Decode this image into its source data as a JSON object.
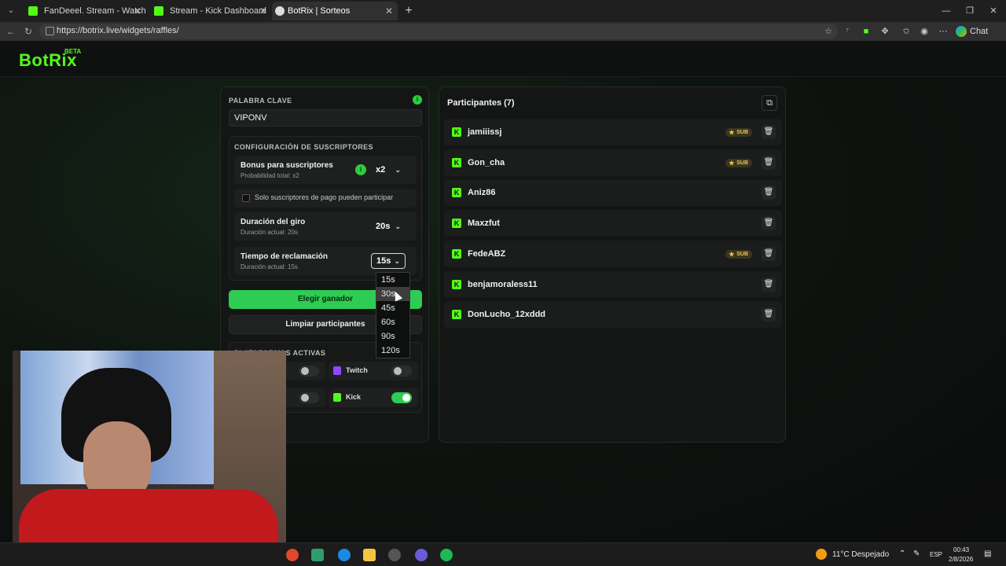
{
  "browser": {
    "tabs": [
      {
        "title": "FanDeeel. Stream - Watch Live on"
      },
      {
        "title": "Stream - Kick Dashboard"
      },
      {
        "title": "BotRix | Sorteos"
      }
    ],
    "url": "https://botrix.live/widgets/raffles/",
    "chat_label": "Chat"
  },
  "app": {
    "logo": "BotRix",
    "beta": "BETA"
  },
  "keyword": {
    "label": "PALABRA CLAVE",
    "value": "VIPONV"
  },
  "subscribers": {
    "section_label": "CONFIGURACIÓN DE SUSCRIPTORES",
    "bonus_title": "Bonus para suscriptores",
    "bonus_sub": "Probabilidad total: x2",
    "bonus_value": "x2",
    "paid_only_label": "Solo suscriptores de pago pueden participar",
    "spin_title": "Duración del giro",
    "spin_sub": "Duración actual: 20s",
    "spin_value": "20s",
    "claim_title": "Tiempo de reclamación",
    "claim_sub": "Duración actual: 15s",
    "claim_value": "15s"
  },
  "claim_options": [
    "15s",
    "30s",
    "45s",
    "60s",
    "90s",
    "120s"
  ],
  "claim_highlight": "30s",
  "actions": {
    "choose_winner": "Elegir ganador",
    "clear": "Limpiar participantes"
  },
  "platforms": {
    "label": "PLATAFORMAS ACTIVAS",
    "items": [
      {
        "name": "",
        "on": false
      },
      {
        "name": "Twitch",
        "on": false
      },
      {
        "name": "",
        "on": false
      },
      {
        "name": "Kick",
        "on": true
      }
    ]
  },
  "participants": {
    "title": "Participantes (7)",
    "sub_badge": "SUB",
    "list": [
      {
        "name": "jamiiissj",
        "sub": true
      },
      {
        "name": "Gon_cha",
        "sub": true
      },
      {
        "name": "Aniz86",
        "sub": false
      },
      {
        "name": "Maxzfut",
        "sub": false
      },
      {
        "name": "FedeABZ",
        "sub": true
      },
      {
        "name": "benjamoraless11",
        "sub": false
      },
      {
        "name": "DonLucho_12xddd",
        "sub": false
      }
    ]
  },
  "taskbar": {
    "weather": "11°C  Despejado",
    "lang": "ESP",
    "time": "00:43",
    "date": "2/8/2026"
  },
  "colors": {
    "kick_green": "#53fc18",
    "accent_green": "#2ecc54",
    "sub_gold": "#f3c84b"
  }
}
